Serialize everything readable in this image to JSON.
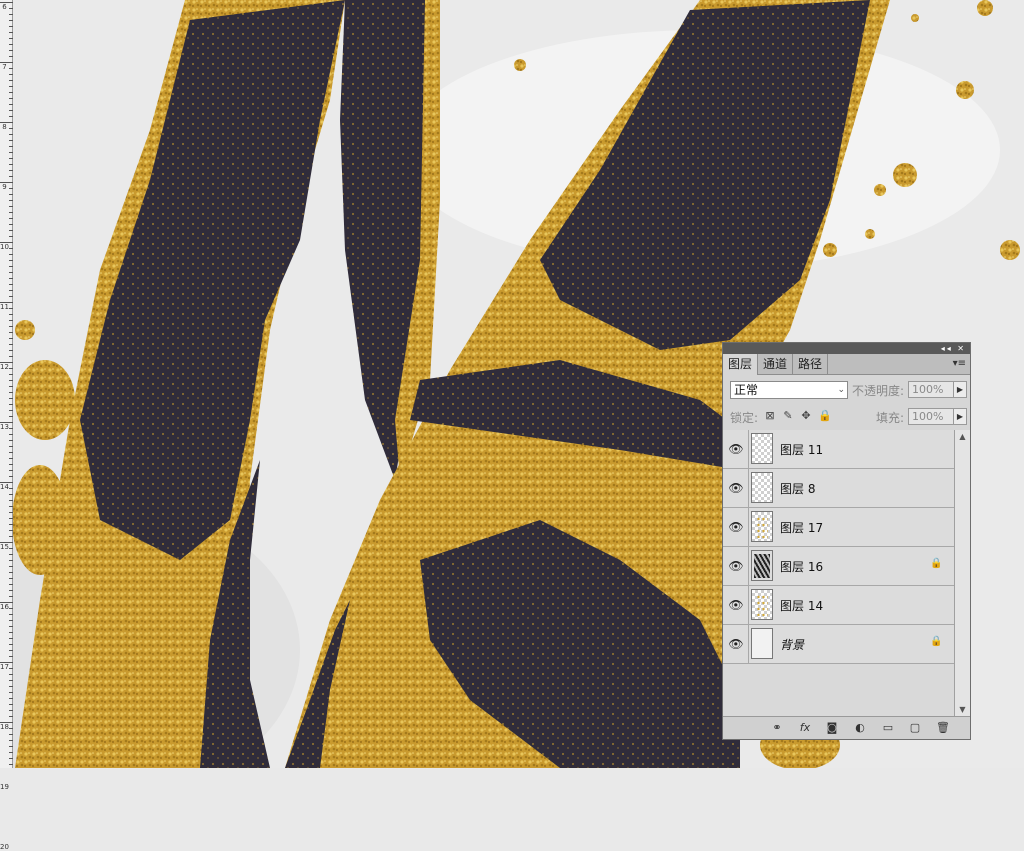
{
  "canvas": {
    "description_colors": {
      "gold": "#c9982c",
      "dark": "#302c3a",
      "paper": "#ebebeb"
    }
  },
  "ruler": {
    "marks": [
      "6",
      "7",
      "8",
      "9",
      "10",
      "11",
      "12",
      "13",
      "14",
      "15",
      "16",
      "17",
      "18",
      "19",
      "20"
    ]
  },
  "panel": {
    "title_buttons": "◂◂ ✕",
    "tabs": [
      {
        "label": "图层",
        "active": true
      },
      {
        "label": "通道",
        "active": false
      },
      {
        "label": "路径",
        "active": false
      }
    ],
    "menu_icon": "▾≡",
    "blend_mode": "正常",
    "opacity_label": "不透明度:",
    "opacity_value": "100%",
    "lock_label": "锁定:",
    "fill_label": "填充:",
    "fill_value": "100%",
    "layers": [
      {
        "name": "图层 11",
        "thumb": "transparent",
        "locked": false
      },
      {
        "name": "图层 8",
        "thumb": "transparent",
        "locked": false
      },
      {
        "name": "图层 17",
        "thumb": "gold",
        "locked": false
      },
      {
        "name": "图层 16",
        "thumb": "dark",
        "locked": true
      },
      {
        "name": "图层 14",
        "thumb": "gold",
        "locked": false
      },
      {
        "name": "背景",
        "thumb": "bg",
        "locked": true
      }
    ],
    "footer_icons": [
      "link-icon",
      "fx-icon",
      "mask-icon",
      "adjustment-icon",
      "group-icon",
      "new-layer-icon",
      "trash-icon"
    ]
  }
}
